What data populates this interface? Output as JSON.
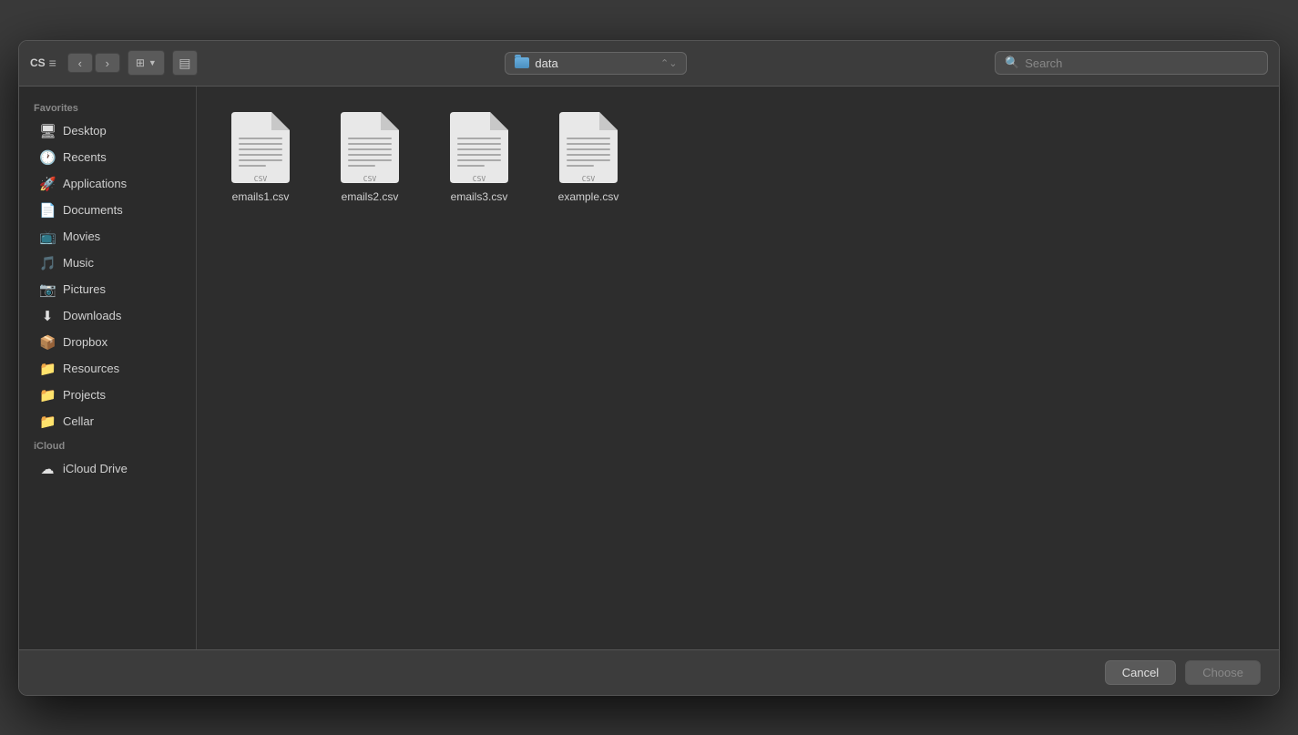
{
  "toolbar": {
    "back_label": "‹",
    "forward_label": "›",
    "view_grid_label": "⊞",
    "view_list_label": "☰",
    "location": "data",
    "search_placeholder": "Search"
  },
  "sidebar": {
    "favorites_label": "Favorites",
    "icloud_label": "iCloud",
    "items": [
      {
        "id": "desktop",
        "label": "Desktop",
        "icon": "🖥"
      },
      {
        "id": "recents",
        "label": "Recents",
        "icon": "🕐"
      },
      {
        "id": "applications",
        "label": "Applications",
        "icon": "🚀"
      },
      {
        "id": "documents",
        "label": "Documents",
        "icon": "📄"
      },
      {
        "id": "movies",
        "label": "Movies",
        "icon": "📺"
      },
      {
        "id": "music",
        "label": "Music",
        "icon": "🎵"
      },
      {
        "id": "pictures",
        "label": "Pictures",
        "icon": "📷"
      },
      {
        "id": "downloads",
        "label": "Downloads",
        "icon": "⬇"
      },
      {
        "id": "dropbox",
        "label": "Dropbox",
        "icon": "📦"
      },
      {
        "id": "resources",
        "label": "Resources",
        "icon": "📁"
      },
      {
        "id": "projects",
        "label": "Projects",
        "icon": "📁"
      },
      {
        "id": "cellar",
        "label": "Cellar",
        "icon": "📁"
      }
    ],
    "icloud_items": [
      {
        "id": "icloud-drive",
        "label": "iCloud Drive",
        "icon": "☁"
      }
    ]
  },
  "files": [
    {
      "id": "emails1",
      "name": "emails1.csv"
    },
    {
      "id": "emails2",
      "name": "emails2.csv"
    },
    {
      "id": "emails3",
      "name": "emails3.csv"
    },
    {
      "id": "example",
      "name": "example.csv"
    }
  ],
  "bottom_bar": {
    "cancel_label": "Cancel",
    "choose_label": "Choose"
  },
  "app": {
    "left_label": "CS"
  }
}
